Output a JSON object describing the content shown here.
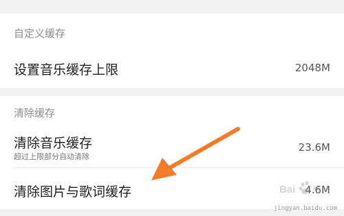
{
  "sections": [
    {
      "header": "自定义缓存",
      "rows": [
        {
          "title": "设置音乐缓存上限",
          "value": "2048M"
        }
      ]
    },
    {
      "header": "清除缓存",
      "rows": [
        {
          "title": "清除音乐缓存",
          "subtitle": "超过上限部分自动清除",
          "value": "23.6M"
        },
        {
          "title": "清除图片与歌词缓存",
          "value": "4.6M"
        }
      ]
    }
  ],
  "annotation": {
    "arrow_color": "#f47b2a",
    "icon": "arrow-pointer-icon"
  },
  "watermark": {
    "logo_text": "Bai 经验",
    "site": "jingyan.baidu.com"
  },
  "colors": {
    "background": "#ffffff",
    "section_gap": "#f2f2f2",
    "header_text": "#8e8e8e"
  }
}
